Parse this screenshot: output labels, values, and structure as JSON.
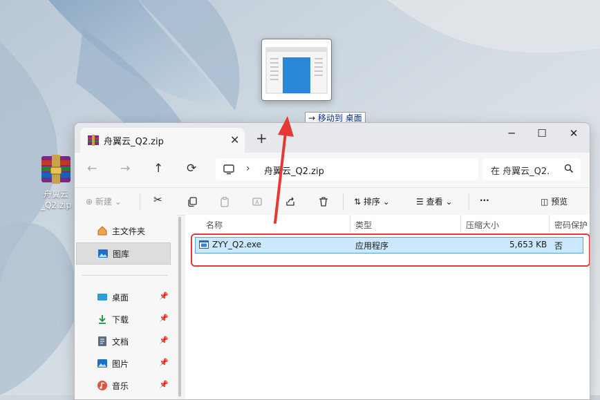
{
  "desktop": {
    "icon_label_1": "舟翼云",
    "icon_label_2": "_Q2.zip"
  },
  "drag": {
    "arrow": "→",
    "action": "移动到",
    "target": "桌面"
  },
  "window": {
    "tab_title": "舟翼云_Q2.zip",
    "new_tab": "+",
    "controls": {
      "minimize": "─",
      "maximize": "☐",
      "close": "✕"
    }
  },
  "address": {
    "path": "舟翼云_Q2.zip",
    "search_placeholder": "在 舟翼云_Q2."
  },
  "toolbar": {
    "new_label": "新建",
    "sort_label": "排序",
    "view_label": "查看",
    "more_label": "···",
    "preview_label": "预览"
  },
  "sidebar": {
    "items": [
      {
        "label": "主文件夹",
        "icon": "home-icon"
      },
      {
        "label": "图库",
        "icon": "gallery-icon"
      },
      {
        "label": "桌面",
        "icon": "desktop-icon"
      },
      {
        "label": "下载",
        "icon": "download-icon"
      },
      {
        "label": "文档",
        "icon": "document-icon"
      },
      {
        "label": "图片",
        "icon": "picture-icon"
      },
      {
        "label": "音乐",
        "icon": "music-icon"
      }
    ]
  },
  "columns": [
    "名称",
    "类型",
    "压缩大小",
    "密码保护"
  ],
  "files": [
    {
      "name": "ZYY_Q2.exe",
      "type": "应用程序",
      "size": "5,653 KB",
      "protected": "否"
    }
  ],
  "colors": {
    "highlight": "#cce8ff",
    "annotation": "#e53935",
    "accent": "#0067c0"
  }
}
